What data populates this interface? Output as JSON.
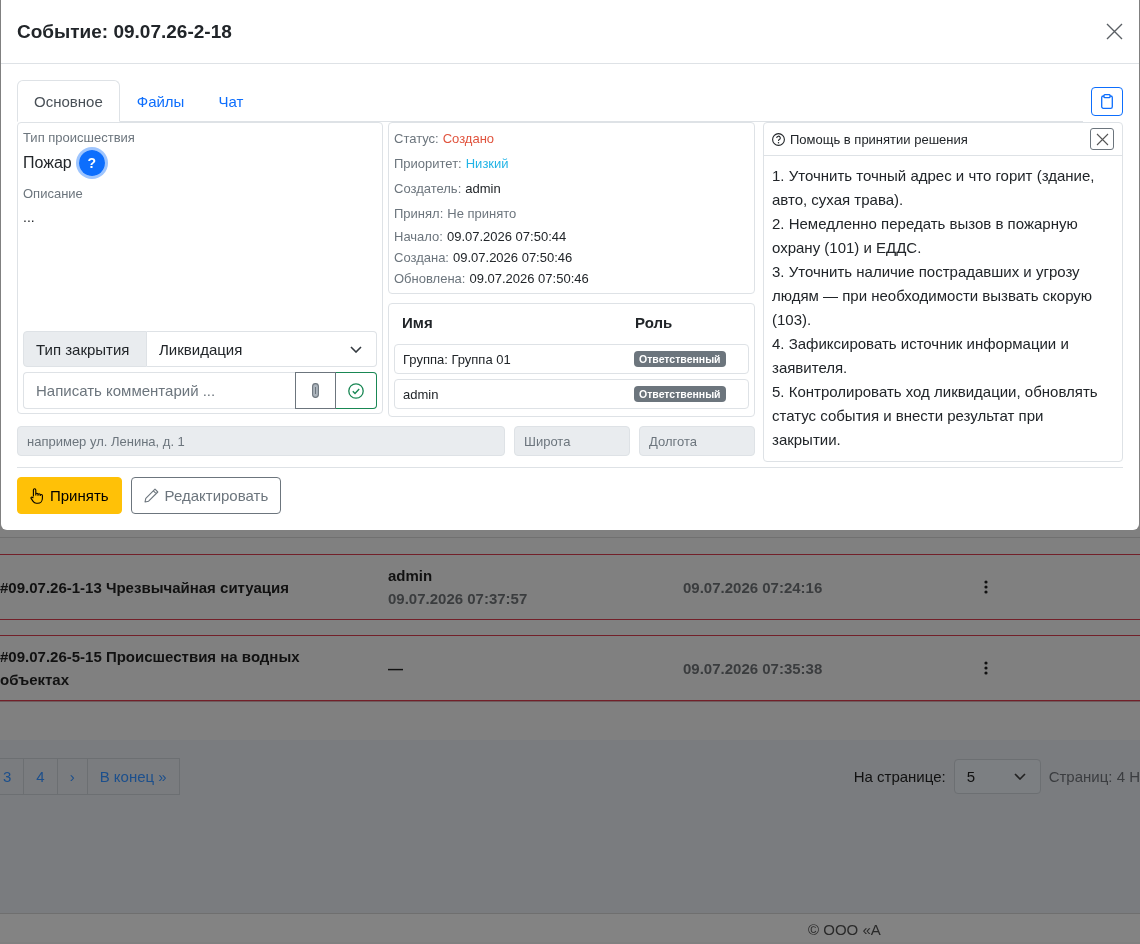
{
  "modal": {
    "title": "Событие: 09.07.26-2-18"
  },
  "tabs": [
    {
      "label": "Основное",
      "selected": true
    },
    {
      "label": "Файлы",
      "selected": false
    },
    {
      "label": "Чат",
      "selected": false
    }
  ],
  "incident": {
    "type_label": "Тип происшествия",
    "type_value": "Пожар",
    "help_button": "?",
    "description_label": "Описание",
    "description_value": "..."
  },
  "closing": {
    "label": "Тип закрытия",
    "value": "Ликвидация"
  },
  "comment": {
    "placeholder": "Написать комментарий ..."
  },
  "details": [
    {
      "label": "Статус:",
      "value": "Создано",
      "color": "#e0533d"
    },
    {
      "label": "Приоритет:",
      "value": "Низкий",
      "color": "#22b4e6"
    },
    {
      "label": "Создатель:",
      "value": "admin",
      "color": "#212529"
    },
    {
      "label": "Принял:",
      "value": "Не принято",
      "color": "#6c757d"
    }
  ],
  "dates": [
    {
      "label": "Начало:",
      "value": "09.07.2026 07:50:44"
    },
    {
      "label": "Создана:",
      "value": "09.07.2026 07:50:46"
    },
    {
      "label": "Обновлена:",
      "value": "09.07.2026 07:50:46"
    }
  ],
  "members": {
    "columns": [
      "Имя",
      "Роль"
    ],
    "rows": [
      {
        "name": "Группа: Группа 01",
        "role": "Ответственный"
      },
      {
        "name": "admin",
        "role": "Ответственный"
      }
    ]
  },
  "location": {
    "disabled": true,
    "address_placeholder": "например ул. Ленина, д. 1",
    "latitude_placeholder": "Широта",
    "longitude_placeholder": "Долгота"
  },
  "help": {
    "title": "Помощь в принятии решения",
    "steps": [
      "1. Уточнить точный адрес и что горит (здание, авто, сухая трава).",
      "2. Немедленно передать вызов в пожарную охрану (101) и ЕДДС.",
      "3. Уточнить наличие пострадавших и угрозу людям — при необходимости вызвать скорую (103).",
      "4. Зафиксировать источник информации и заявителя.",
      "5. Контролировать ход ликвидации, обновлять статус события и внести результат при закрытии."
    ]
  },
  "actions": [
    {
      "label": "Принять",
      "kind": "accept"
    },
    {
      "label": "Редактировать",
      "kind": "edit"
    }
  ],
  "background": {
    "events": [
      {
        "title": "#09.07.26-1-13 Чрезвычайная ситуация",
        "accepted_by": "admin",
        "accepted_at": "09.07.2026 07:37:57",
        "created": "09.07.2026 07:24:16"
      },
      {
        "title": "#09.07.26-5-15 Происшествия на водных объектах",
        "accepted_by": "—",
        "created": "09.07.2026 07:35:38"
      }
    ],
    "pagination": [
      "3",
      "4",
      "›",
      "В конец »"
    ],
    "per_page_label": "На странице:",
    "per_page_value": "5",
    "pages_info": "Страниц: 4 Н",
    "footer": "© ООО «А"
  }
}
